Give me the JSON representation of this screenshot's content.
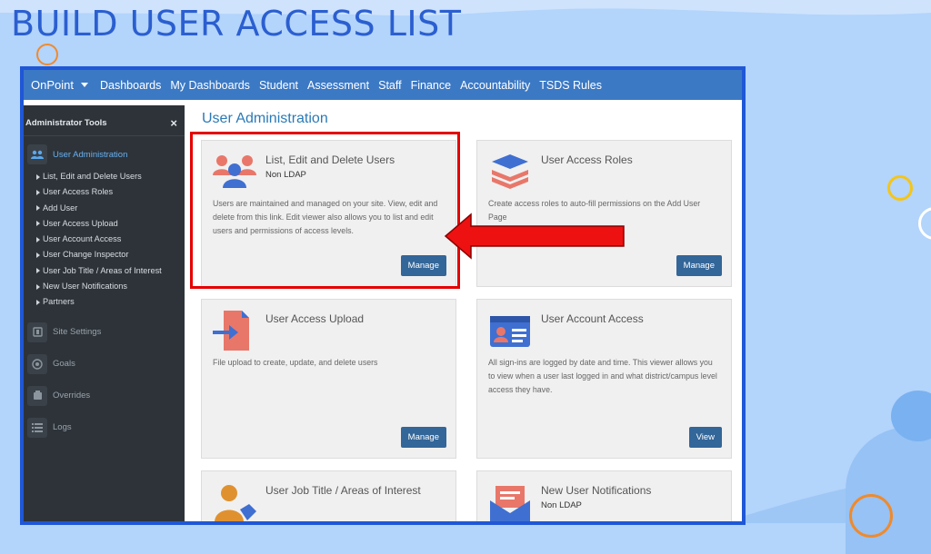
{
  "slide": {
    "title": "BUILD USER ACCESS LIST"
  },
  "navbar": {
    "brand": "OnPoint",
    "links": [
      "Dashboards",
      "My Dashboards",
      "Student",
      "Assessment",
      "Staff",
      "Finance",
      "Accountability",
      "TSDS Rules"
    ]
  },
  "sidebar": {
    "title": "Administrator Tools",
    "close": "×",
    "active_section": {
      "label": "User Administration",
      "icon": "users-icon"
    },
    "items": [
      "List, Edit and Delete Users",
      "User Access Roles",
      "Add User",
      "User Access Upload",
      "User Account Access",
      "User Change Inspector",
      "User Job Title / Areas of Interest",
      "New User Notifications",
      "Partners"
    ],
    "sections": [
      {
        "label": "Site Settings",
        "icon": "settings-icon"
      },
      {
        "label": "Goals",
        "icon": "target-icon"
      },
      {
        "label": "Overrides",
        "icon": "override-icon"
      },
      {
        "label": "Logs",
        "icon": "list-icon"
      }
    ]
  },
  "main": {
    "title": "User Administration",
    "cards": [
      {
        "title": "List, Edit and Delete Users",
        "subtitle": "Non LDAP",
        "description": "Users are maintained and managed on your site. View, edit and delete from this link. Edit viewer also allows you to list and edit users and permissions of access levels.",
        "button": "Manage",
        "icon": "users-group-icon"
      },
      {
        "title": "User Access Roles",
        "subtitle": "",
        "description": "Create access roles to auto-fill permissions on the Add User Page",
        "button": "Manage",
        "icon": "layers-icon"
      },
      {
        "title": "User Access Upload",
        "subtitle": "",
        "description": "File upload to create, update, and delete users",
        "button": "Manage",
        "icon": "file-import-icon"
      },
      {
        "title": "User Account Access",
        "subtitle": "",
        "description": "All sign-ins are logged by date and time. This viewer allows you to view when a user last logged in and what district/campus level access they have.",
        "button": "View",
        "icon": "id-card-icon"
      },
      {
        "title": "User Job Title / Areas of Interest",
        "subtitle": "",
        "description": "",
        "button": "",
        "icon": "user-tag-icon"
      },
      {
        "title": "New User Notifications",
        "subtitle": "Non LDAP",
        "description": "",
        "button": "",
        "icon": "envelope-icon"
      }
    ]
  },
  "colors": {
    "accent": "#2a7ab8",
    "navbar": "#3c79c4",
    "sidebar": "#2d3339",
    "button": "#336699",
    "highlight": "#e50000"
  }
}
